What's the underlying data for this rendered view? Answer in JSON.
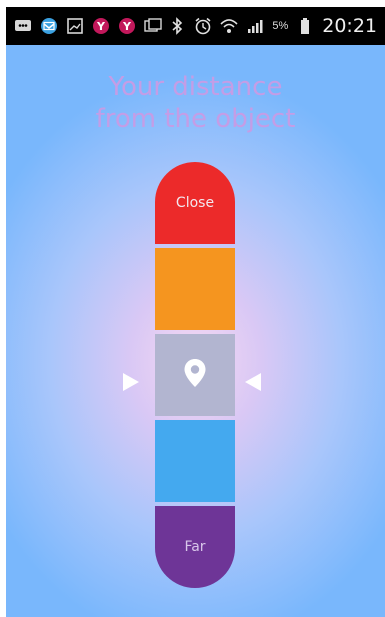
{
  "status_bar": {
    "time": "20:21",
    "battery_percent": "5%",
    "icons_left": [
      "messages-icon",
      "mail-icon",
      "gallery-icon",
      "yahoo-icon",
      "yahoo-icon",
      "media-icon"
    ],
    "icons_right": [
      "bluetooth-icon",
      "alarm-icon",
      "wifi-icon",
      "signal-icon",
      "battery-icon"
    ]
  },
  "title": {
    "line1": "Your distance",
    "line2": "from the object"
  },
  "scale": {
    "close_label": "Close",
    "far_label": "Far",
    "center_icon": "location-pin-icon",
    "colors": {
      "close": "#ec2a2a",
      "near": "#f5951f",
      "current": "#b2b5d0",
      "distant": "#44a9ef",
      "far": "#6e3597"
    }
  },
  "colors": {
    "title": "#c49de6",
    "background_center": "#f4d8f2",
    "background_edge": "#79b7fc"
  }
}
